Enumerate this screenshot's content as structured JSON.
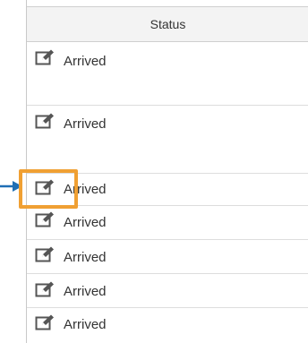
{
  "table": {
    "header": {
      "status_label": "Status"
    },
    "rows": [
      {
        "status": "Arrived",
        "edit_icon": "edit-pencil-icon"
      },
      {
        "status": "Arrived",
        "edit_icon": "edit-pencil-icon"
      },
      {
        "status": "Arrived",
        "edit_icon": "edit-pencil-icon"
      },
      {
        "status": "Arrived",
        "edit_icon": "edit-pencil-icon"
      },
      {
        "status": "Arrived",
        "edit_icon": "edit-pencil-icon"
      },
      {
        "status": "Arrived",
        "edit_icon": "edit-pencil-icon"
      },
      {
        "status": "Arrived",
        "edit_icon": "edit-pencil-icon"
      }
    ]
  },
  "annotation": {
    "highlight_color": "#f0a033",
    "arrow_color": "#1f6fb5"
  }
}
